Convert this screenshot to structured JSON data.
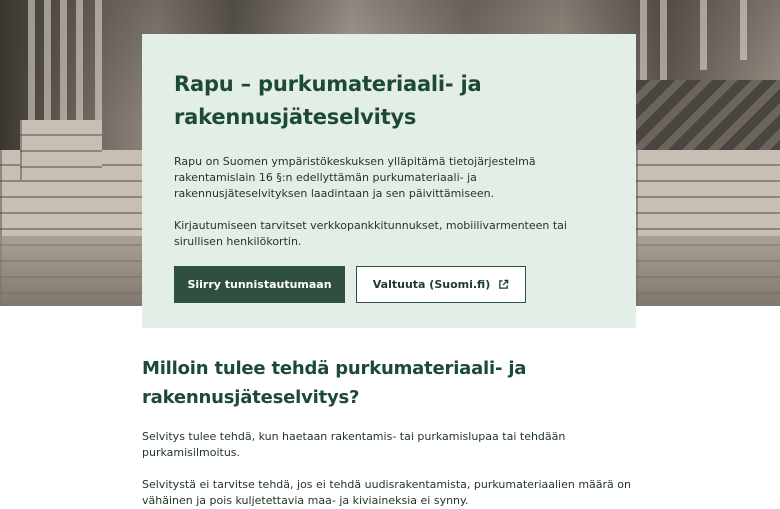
{
  "hero": {
    "image": "construction-materials-photo",
    "title": "Rapu – purkumateriaali- ja rakennusjäteselvitys",
    "intro": "Rapu on Suomen ympäristökeskuksen ylläpitämä tietojärjestelmä rakentamislain 16 §:n edellyttämän purkumateriaali- ja rakennusjäteselvityksen laadintaan ja sen päivittämiseen.",
    "login_note": "Kirjautumiseen tarvitset verkkopankkitunnukset, mobiilivarmenteen tai sirullisen henkilökortin.",
    "primary_button": "Siirry tunnistautumaan",
    "secondary_button": "Valtuuta (Suomi.fi)",
    "secondary_icon": "external-link-icon"
  },
  "section": {
    "heading": "Milloin tulee tehdä purkumateriaali- ja rakennusjäteselvitys?",
    "paragraph1": "Selvitys tulee tehdä, kun haetaan rakentamis- tai purkamislupaa tai tehdään purkamisilmoitus.",
    "paragraph2": "Selvitystä ei tarvitse tehdä, jos ei tehdä uudisrakentamista, purkumateriaalien määrä on vähäinen ja pois kuljetettavia maa- ja kiviaineksia ei synny."
  },
  "colors": {
    "card_bg": "#e3eee6",
    "primary": "#2f4f3f",
    "heading": "#1d4a35"
  }
}
